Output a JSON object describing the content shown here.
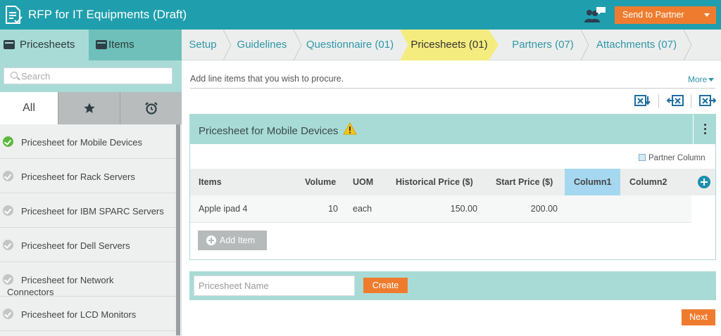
{
  "header": {
    "title": "RFP for IT Equipments (Draft)",
    "send_button": "Send to Partner",
    "doc_icon": "document-list-icon",
    "partners_icon": "partners-chat-icon"
  },
  "sidebar": {
    "tabs": [
      {
        "label": "Pricesheets",
        "icon": "sheet-icon"
      },
      {
        "label": "Items",
        "icon": "sheet-icon"
      }
    ],
    "search_placeholder": "Search",
    "filters": {
      "all_label": "All",
      "star_icon": "star-icon",
      "clock_icon": "alarm-clock-icon"
    },
    "items": [
      {
        "label": "Pricesheet for Mobile Devices",
        "status": "complete"
      },
      {
        "label": "Pricesheet for Rack Servers",
        "status": "pending"
      },
      {
        "label": "Pricesheet for IBM SPARC Servers",
        "status": "pending"
      },
      {
        "label": "Pricesheet for Dell Servers",
        "status": "pending"
      },
      {
        "label": "Pricesheet for Network Connectors",
        "status": "pending"
      },
      {
        "label": "Pricesheet for LCD Monitors",
        "status": "pending"
      }
    ]
  },
  "steps": [
    {
      "label": "Setup"
    },
    {
      "label": "Guidelines"
    },
    {
      "label": "Questionnaire (01)"
    },
    {
      "label": "Pricesheets (01)",
      "active": true
    },
    {
      "label": "Partners (07)"
    },
    {
      "label": "Attachments (07)"
    }
  ],
  "main": {
    "intro": "Add line items that you wish to procure.",
    "more_label": "More",
    "tools": [
      "excel-download-icon",
      "excel-import-icon",
      "excel-export-icon"
    ]
  },
  "pricesheet": {
    "title": "Pricesheet for Mobile Devices",
    "partner_column_label": "Partner Column",
    "columns": [
      "Items",
      "Volume",
      "UOM",
      "Historical Price ($)",
      "Start Price ($)",
      "Column1",
      "Column2"
    ],
    "rows": [
      {
        "item": "Apple ipad 4",
        "volume": "10",
        "uom": "each",
        "historical": "150.00",
        "start": "200.00",
        "col1": "",
        "col2": ""
      }
    ],
    "add_item_label": "Add Item"
  },
  "create": {
    "placeholder": "Pricesheet Name",
    "button": "Create"
  },
  "footer": {
    "next_label": "Next"
  },
  "colors": {
    "header_bg": "#1f9fad",
    "accent_orange": "#ef7c2e",
    "panel_teal": "#a9dbd6",
    "active_step": "#f5ec7f",
    "link": "#2f96a6"
  }
}
